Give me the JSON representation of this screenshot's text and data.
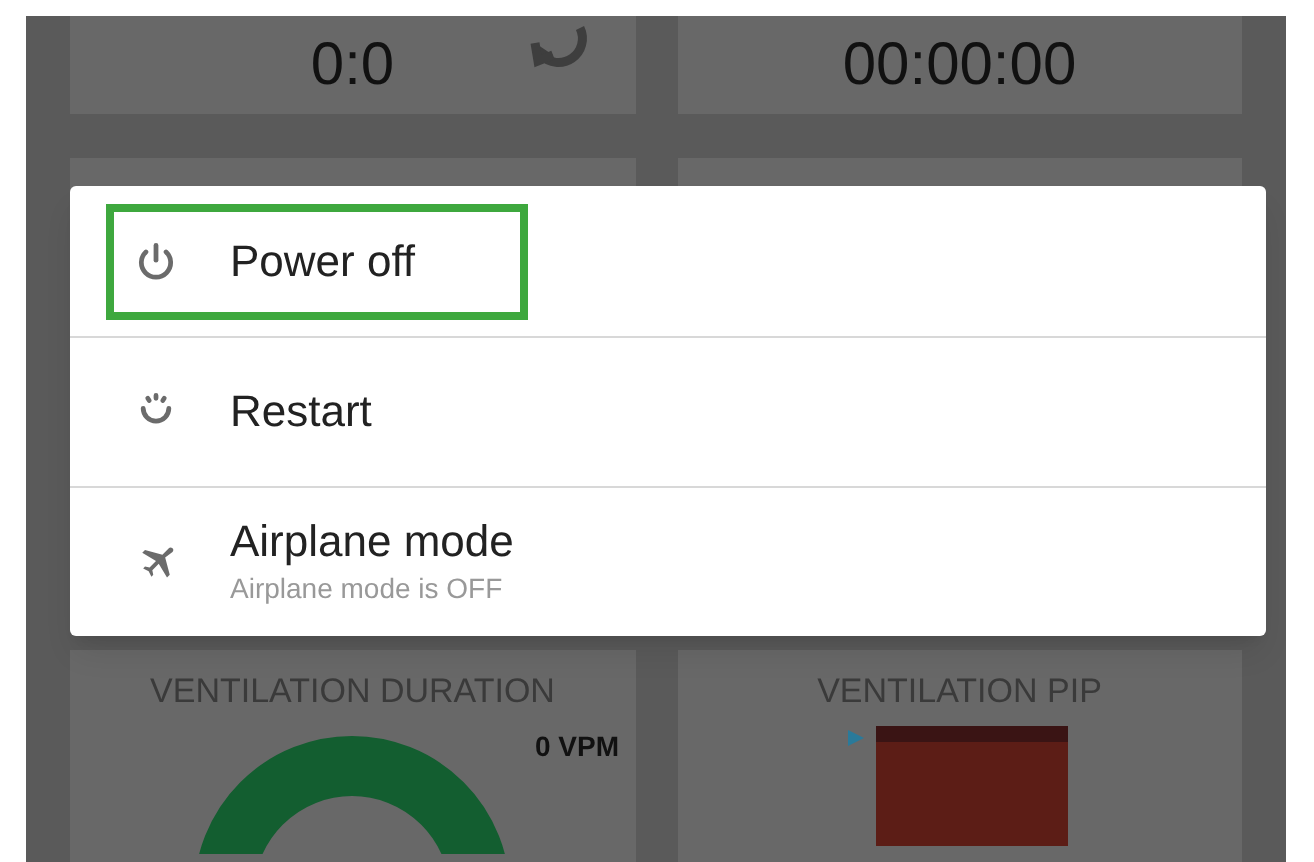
{
  "top_cards": [
    {
      "value": "0:0"
    },
    {
      "value": "00:00:00"
    }
  ],
  "bottom_cards": [
    {
      "kind": "donut",
      "title": "VENTILATION DURATION",
      "reading": "0 VPM"
    },
    {
      "kind": "bar",
      "title": "VENTILATION PIP"
    }
  ],
  "power_menu": [
    {
      "kind": "power",
      "label": "Power off",
      "highlighted": true
    },
    {
      "kind": "restart",
      "label": "Restart",
      "highlighted": false
    },
    {
      "kind": "airplane",
      "label": "Airplane mode",
      "subtitle": "Airplane mode is OFF",
      "highlighted": false
    }
  ]
}
